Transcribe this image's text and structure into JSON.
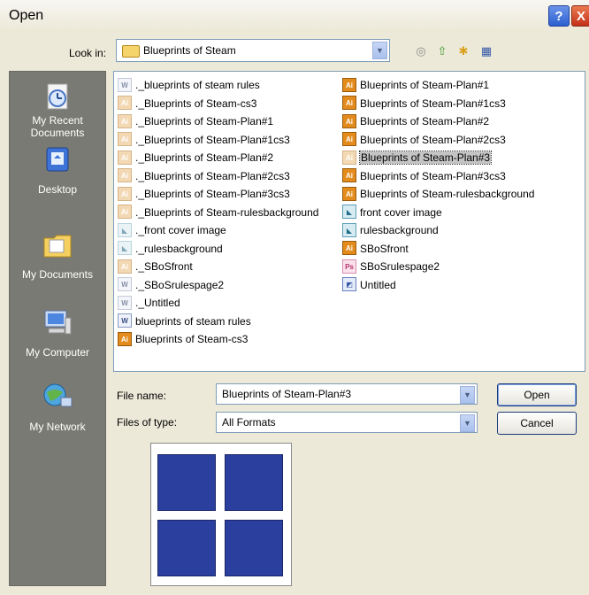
{
  "window": {
    "title": "Open",
    "help_glyph": "?",
    "close_glyph": "X"
  },
  "lookin": {
    "label": "Look in:",
    "value": "Blueprints of Steam"
  },
  "toolbar": {
    "back_glyph": "◎",
    "up_glyph": "⇧",
    "newfolder_glyph": "✱",
    "views_glyph": "▦"
  },
  "places": [
    {
      "label_line1": "My Recent",
      "label_line2": "Documents",
      "icon": "recent-documents-icon"
    },
    {
      "label_line1": "Desktop",
      "label_line2": "",
      "icon": "desktop-icon"
    },
    {
      "label_line1": "My Documents",
      "label_line2": "",
      "icon": "my-documents-icon"
    },
    {
      "label_line1": "My Computer",
      "label_line2": "",
      "icon": "my-computer-icon"
    },
    {
      "label_line1": "My Network",
      "label_line2": "",
      "icon": "my-network-icon"
    }
  ],
  "files_col1": [
    {
      "name": "._blueprints of steam rules",
      "type": "doc-ghost"
    },
    {
      "name": "._Blueprints of Steam-cs3",
      "type": "ai-ghost"
    },
    {
      "name": "._Blueprints of Steam-Plan#1",
      "type": "ai-ghost"
    },
    {
      "name": "._Blueprints of Steam-Plan#1cs3",
      "type": "ai-ghost"
    },
    {
      "name": "._Blueprints of Steam-Plan#2",
      "type": "ai-ghost"
    },
    {
      "name": "._Blueprints of Steam-Plan#2cs3",
      "type": "ai-ghost"
    },
    {
      "name": "._Blueprints of Steam-Plan#3cs3",
      "type": "ai-ghost"
    },
    {
      "name": "._Blueprints of Steam-rulesbackground",
      "type": "ai-ghost"
    },
    {
      "name": "._front cover image",
      "type": "img-ghost"
    },
    {
      "name": "._rulesbackground",
      "type": "img-ghost"
    },
    {
      "name": "._SBoSfront",
      "type": "ai-ghost"
    },
    {
      "name": "._SBoSrulespage2",
      "type": "doc-ghost"
    },
    {
      "name": "._Untitled",
      "type": "doc-ghost"
    },
    {
      "name": "blueprints of steam rules",
      "type": "doc"
    },
    {
      "name": "Blueprints of Steam-cs3",
      "type": "ai"
    }
  ],
  "files_col2": [
    {
      "name": "Blueprints of Steam-Plan#1",
      "type": "ai"
    },
    {
      "name": "Blueprints of Steam-Plan#1cs3",
      "type": "ai"
    },
    {
      "name": "Blueprints of Steam-Plan#2",
      "type": "ai"
    },
    {
      "name": "Blueprints of Steam-Plan#2cs3",
      "type": "ai"
    },
    {
      "name": "Blueprints of Steam-Plan#3",
      "type": "ai-ghost",
      "selected": true
    },
    {
      "name": "Blueprints of Steam-Plan#3cs3",
      "type": "ai"
    },
    {
      "name": "Blueprints of Steam-rulesbackground",
      "type": "ai"
    },
    {
      "name": "front cover image",
      "type": "img"
    },
    {
      "name": "rulesbackground",
      "type": "img"
    },
    {
      "name": "SBoSfront",
      "type": "ai"
    },
    {
      "name": "SBoSrulespage2",
      "type": "ps"
    },
    {
      "name": "Untitled",
      "type": "pdf"
    }
  ],
  "icon_glyphs": {
    "ai": "Ai",
    "ai-ghost": "Ai",
    "doc": "W",
    "doc-ghost": "W",
    "img": "◣",
    "img-ghost": "◣",
    "ps": "Ps",
    "pdf": "◩"
  },
  "filename": {
    "label": "File name:",
    "value": "Blueprints of Steam-Plan#3"
  },
  "filetype": {
    "label": "Files of type:",
    "value": "All Formats"
  },
  "buttons": {
    "open": "Open",
    "cancel": "Cancel"
  },
  "combo_glyph": "▼"
}
